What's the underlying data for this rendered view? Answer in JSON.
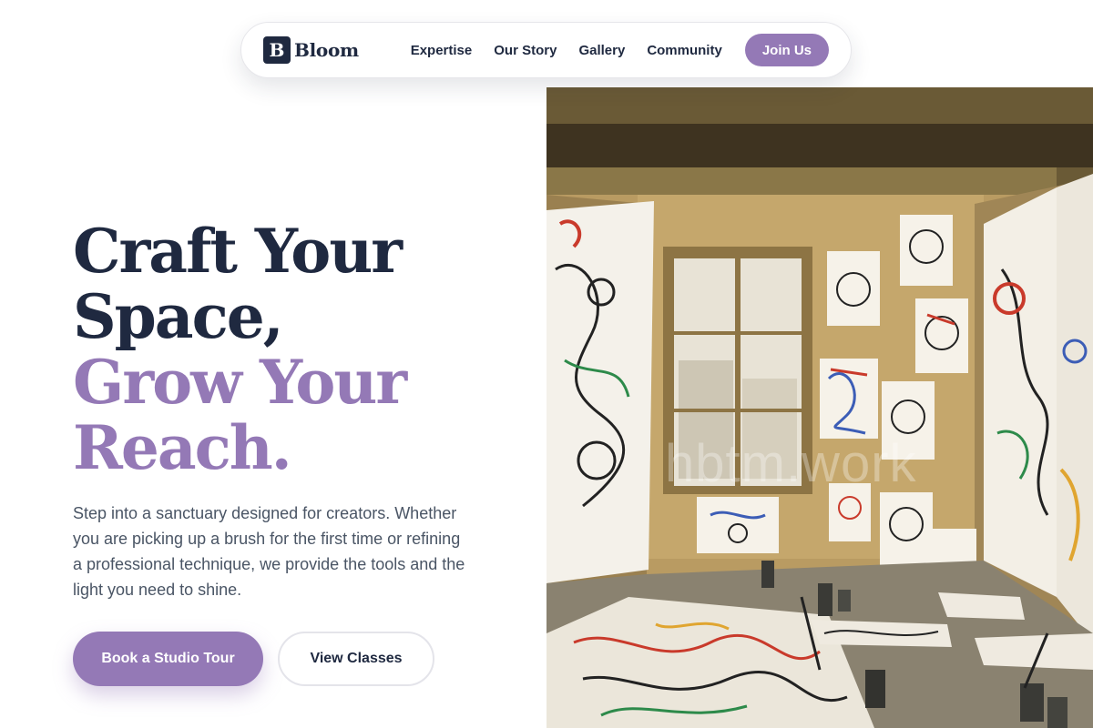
{
  "nav": {
    "brand_letter": "B",
    "brand_name": "Bloom",
    "links": [
      "Expertise",
      "Our Story",
      "Gallery",
      "Community"
    ],
    "cta": "Join Us"
  },
  "hero": {
    "headline": [
      "Craft Your",
      "Space,",
      "Grow Your",
      "Reach."
    ],
    "description": "Step into a sanctuary designed for creators. Whether you are picking up a brush for the first time or refining a professional technique, we provide the tools and the light you need to shine.",
    "primary_cta": "Book a Studio Tour",
    "secondary_cta": "View Classes",
    "image_watermark": "hbtm.work"
  },
  "colors": {
    "accent": "#9479b6",
    "navy": "#1f2940",
    "body_text": "#4a5565"
  },
  "icons": {
    "brand_mark": "letter-b-logo"
  }
}
